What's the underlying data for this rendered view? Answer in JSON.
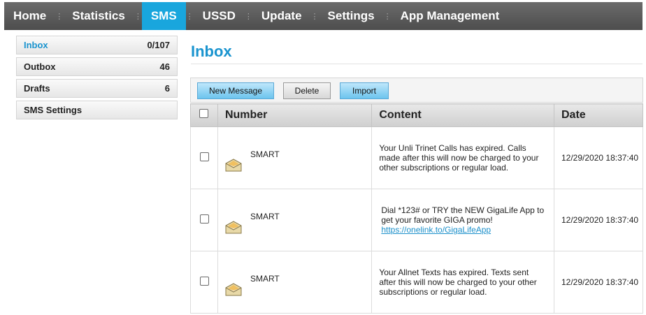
{
  "nav": {
    "items": [
      "Home",
      "Statistics",
      "SMS",
      "USSD",
      "Update",
      "Settings",
      "App Management"
    ],
    "active": "SMS"
  },
  "sidebar": {
    "items": [
      {
        "label": "Inbox",
        "count": "0/107"
      },
      {
        "label": "Outbox",
        "count": "46"
      },
      {
        "label": "Drafts",
        "count": "6"
      },
      {
        "label": "SMS Settings",
        "count": ""
      }
    ]
  },
  "page": {
    "title": "Inbox"
  },
  "toolbar": {
    "new_message": "New Message",
    "delete": "Delete",
    "import": "Import"
  },
  "table": {
    "headers": {
      "number": "Number",
      "content": "Content",
      "date": "Date"
    },
    "rows": [
      {
        "number": "SMART",
        "content": "Your Unli Trinet Calls has expired. Calls made after this will now be charged to your other subscriptions or regular load.",
        "link": "",
        "date": "12/29/2020 18:37:40"
      },
      {
        "number": "SMART",
        "content": "Dial *123# or TRY the NEW GigaLife App to get your favorite GIGA promo!",
        "link": "https://onelink.to/GigaLifeApp",
        "date": "12/29/2020 18:37:40"
      },
      {
        "number": "SMART",
        "content": "Your Allnet Texts has expired. Texts sent after this will now be charged to your other subscriptions or regular load.",
        "link": "",
        "date": "12/29/2020 18:37:40"
      }
    ]
  },
  "colors": {
    "accent": "#19a6dd",
    "topbar": "#555555",
    "title": "#1a94cf"
  }
}
